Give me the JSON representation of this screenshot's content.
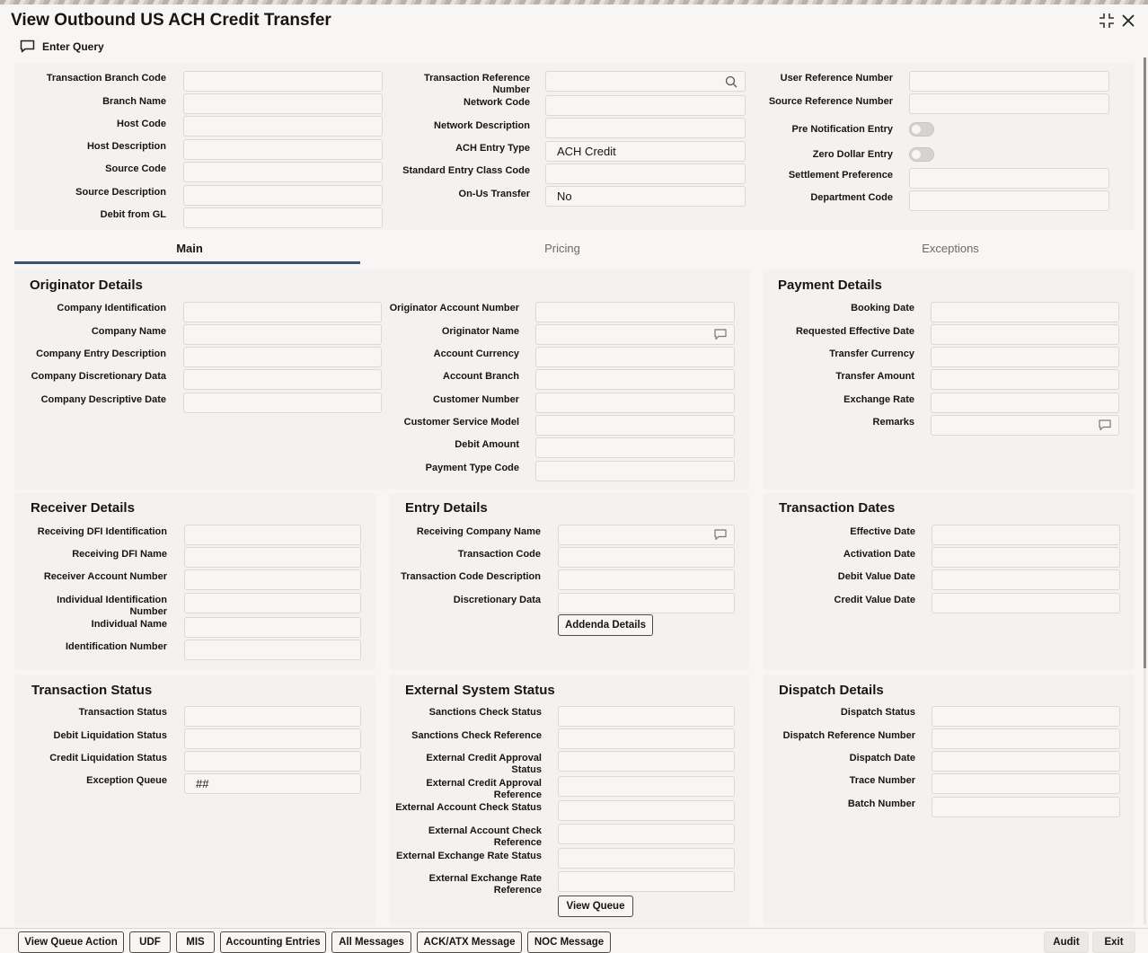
{
  "window": {
    "title": "View Outbound US ACH Credit Transfer"
  },
  "toolbar": {
    "enter_query": "Enter Query"
  },
  "header": {
    "transaction_branch_code": {
      "label": "Transaction Branch Code",
      "value": ""
    },
    "branch_name": {
      "label": "Branch Name",
      "value": ""
    },
    "host_code": {
      "label": "Host Code",
      "value": ""
    },
    "host_description": {
      "label": "Host Description",
      "value": ""
    },
    "source_code": {
      "label": "Source Code",
      "value": ""
    },
    "source_description": {
      "label": "Source Description",
      "value": ""
    },
    "debit_from_gl": {
      "label": "Debit from GL",
      "value": ""
    },
    "transaction_reference_number": {
      "label": "Transaction Reference Number",
      "value": ""
    },
    "network_code": {
      "label": "Network Code",
      "value": ""
    },
    "network_description": {
      "label": "Network Description",
      "value": ""
    },
    "ach_entry_type": {
      "label": "ACH Entry Type",
      "value": "ACH Credit"
    },
    "standard_entry_class_code": {
      "label": "Standard Entry Class Code",
      "value": ""
    },
    "on_us_transfer": {
      "label": "On-Us Transfer",
      "value": "No"
    },
    "user_reference_number": {
      "label": "User Reference Number",
      "value": ""
    },
    "source_reference_number": {
      "label": "Source Reference Number",
      "value": ""
    },
    "pre_notification_entry": {
      "label": "Pre Notification Entry",
      "on": false
    },
    "zero_dollar_entry": {
      "label": "Zero Dollar Entry",
      "on": false
    },
    "settlement_preference": {
      "label": "Settlement Preference",
      "value": ""
    },
    "department_code": {
      "label": "Department Code",
      "value": ""
    }
  },
  "tabs": [
    {
      "label": "Main",
      "active": true
    },
    {
      "label": "Pricing",
      "active": false
    },
    {
      "label": "Exceptions",
      "active": false
    }
  ],
  "originator_details": {
    "title": "Originator Details",
    "company_identification": "Company Identification",
    "company_name": "Company Name",
    "company_entry_description": "Company Entry Description",
    "company_discretionary_data": "Company Discretionary Data",
    "company_descriptive_date": "Company Descriptive Date",
    "originator_account_number": "Originator Account Number",
    "originator_name": "Originator Name",
    "account_currency": "Account Currency",
    "account_branch": "Account Branch",
    "customer_number": "Customer Number",
    "customer_service_model": "Customer Service Model",
    "debit_amount": "Debit Amount",
    "payment_type_code": "Payment Type Code"
  },
  "payment_details": {
    "title": "Payment Details",
    "booking_date": "Booking Date",
    "requested_effective_date": "Requested Effective Date",
    "transfer_currency": "Transfer Currency",
    "transfer_amount": "Transfer Amount",
    "exchange_rate": "Exchange Rate",
    "remarks": "Remarks"
  },
  "receiver_details": {
    "title": "Receiver Details",
    "receiving_dfi_identification": "Receiving DFI Identification",
    "receiving_dfi_name": "Receiving DFI Name",
    "receiver_account_number": "Receiver Account Number",
    "individual_identification_number": "Individual Identification Number",
    "individual_name": "Individual Name",
    "identification_number": "Identification Number"
  },
  "entry_details": {
    "title": "Entry Details",
    "receiving_company_name": "Receiving Company Name",
    "transaction_code": "Transaction Code",
    "transaction_code_description": "Transaction Code Description",
    "discretionary_data": "Discretionary Data",
    "addenda_button": "Addenda Details"
  },
  "transaction_dates": {
    "title": "Transaction Dates",
    "effective_date": "Effective Date",
    "activation_date": "Activation Date",
    "debit_value_date": "Debit Value Date",
    "credit_value_date": "Credit Value Date"
  },
  "transaction_status": {
    "title": "Transaction Status",
    "transaction_status": "Transaction Status",
    "debit_liquidation_status": "Debit Liquidation Status",
    "credit_liquidation_status": "Credit Liquidation Status",
    "exception_queue": {
      "label": "Exception Queue",
      "value": "##"
    }
  },
  "external_system_status": {
    "title": "External System Status",
    "sanctions_check_status": "Sanctions Check Status",
    "sanctions_check_reference": "Sanctions Check Reference",
    "external_credit_approval_status": "External Credit Approval Status",
    "external_credit_approval_reference": "External Credit Approval Reference",
    "external_account_check_status": "External Account Check Status",
    "external_account_check_reference": "External Account Check Reference",
    "external_exchange_rate_status": "External Exchange Rate Status",
    "external_exchange_rate_reference": "External Exchange Rate Reference",
    "view_queue_button": "View Queue"
  },
  "dispatch_details": {
    "title": "Dispatch Details",
    "dispatch_status": "Dispatch Status",
    "dispatch_reference_number": "Dispatch Reference Number",
    "dispatch_date": "Dispatch Date",
    "trace_number": "Trace Number",
    "batch_number": "Batch Number"
  },
  "footer": {
    "view_queue_action": "View Queue Action",
    "udf": "UDF",
    "mis": "MIS",
    "accounting_entries": "Accounting Entries",
    "all_messages": "All Messages",
    "ack_atx_message": "ACK/ATX Message",
    "noc_message": "NOC Message",
    "audit": "Audit",
    "exit": "Exit"
  },
  "icons": {
    "enter_query": "chat-bubble-icon",
    "minimize": "collapse-icon",
    "close": "close-icon",
    "search": "search-icon",
    "comment": "comment-icon"
  },
  "colors": {
    "accent": "#3b5270",
    "card": "#f3f2f0",
    "page": "#f7f6f4"
  }
}
